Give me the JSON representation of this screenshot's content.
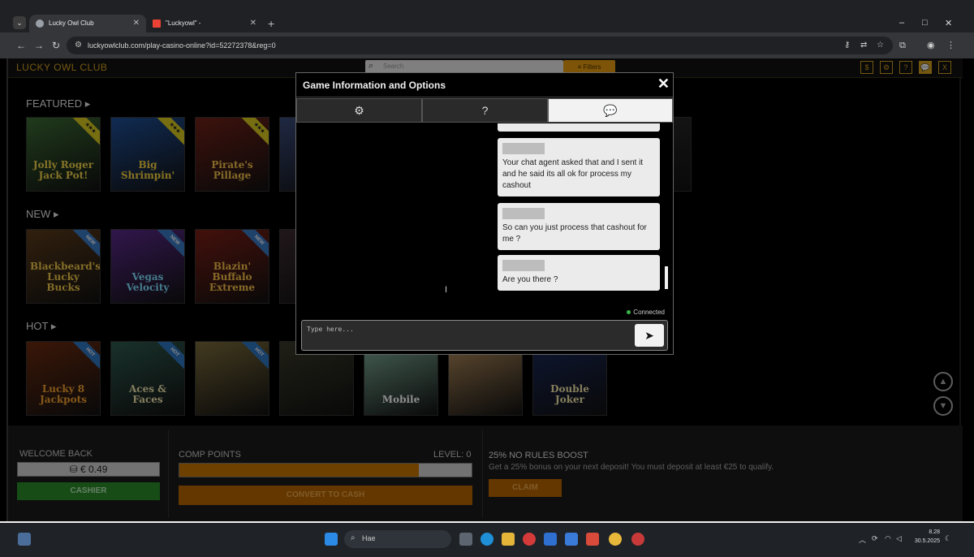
{
  "browser": {
    "tabs": [
      {
        "title": "Lucky Owl Club",
        "favicon_color": "#9aa0a6"
      },
      {
        "title": "\"Luckyowl\" -",
        "favicon_color": "#ea4335"
      }
    ],
    "new_tab": "+",
    "url": "luckyowlclub.com/play-casino-online?id=52272378&reg=0",
    "window_controls": [
      "–",
      "□",
      "✕"
    ]
  },
  "site": {
    "logo": "LUCKY OWL CLUB",
    "search_placeholder": "Search",
    "filters_label": "Filters",
    "header_icons": [
      "$",
      "⚙",
      "?",
      "💬",
      "X"
    ]
  },
  "sections": [
    {
      "title": "FEATURED ▸",
      "tiles": [
        {
          "name": "Jolly Roger Jack Pot!",
          "ribbon": "★★★",
          "bg": "#3b6a34",
          "fg": "#f3d34a"
        },
        {
          "name": "Big Shrimpin'",
          "ribbon": "★★★",
          "bg": "#1f4f96",
          "fg": "#f7d23e"
        },
        {
          "name": "Pirate's Pillage",
          "ribbon": "★★★",
          "bg": "#6f2118",
          "fg": "#f2c24a"
        },
        {
          "name": "",
          "ribbon": "",
          "bg": "#3a4a7a",
          "fg": "#f2c24a"
        },
        {
          "name": "",
          "ribbon": "",
          "bg": "#2a2520",
          "fg": "#ccc"
        },
        {
          "name": "",
          "ribbon": "",
          "bg": "#1f2b30",
          "fg": "#ccc"
        },
        {
          "name": "",
          "ribbon": "",
          "bg": "#252525",
          "fg": "#ccc"
        },
        {
          "name": "",
          "ribbon": "",
          "bg": "#2a2a2a",
          "fg": "#ccc"
        }
      ]
    },
    {
      "title": "NEW ▸",
      "tiles": [
        {
          "name": "Blackbeard's Lucky Bucks",
          "ribbon": "NEW",
          "bg": "#5a3a1a",
          "fg": "#f1c84a"
        },
        {
          "name": "Vegas Velocity",
          "ribbon": "NEW",
          "bg": "#5a2a8a",
          "fg": "#7fe0ff"
        },
        {
          "name": "Blazin' Buffalo Extreme",
          "ribbon": "NEW",
          "bg": "#7a1f15",
          "fg": "#f7c24a"
        },
        {
          "name": "",
          "ribbon": "",
          "bg": "#3a2a30",
          "fg": "#ccc"
        }
      ]
    },
    {
      "title": "HOT ▸",
      "tiles": [
        {
          "name": "Lucky 8 Jackpots",
          "ribbon": "HOT",
          "bg": "#6a2a10",
          "fg": "#f2a030"
        },
        {
          "name": "Aces & Faces",
          "ribbon": "HOT",
          "bg": "#2f5a4e",
          "fg": "#f1e6b0"
        },
        {
          "name": "",
          "ribbon": "HOT",
          "bg": "#7a6a3a",
          "fg": "#fff"
        },
        {
          "name": "",
          "ribbon": "",
          "bg": "#3a3a2a",
          "fg": "#fff"
        },
        {
          "name": "Mobile",
          "ribbon": "",
          "bg": "#7faf9a",
          "fg": "#ffffff"
        },
        {
          "name": "",
          "ribbon": "",
          "bg": "#b08a5a",
          "fg": "#fff"
        },
        {
          "name": "Double Joker",
          "ribbon": "",
          "bg": "#1a2a5a",
          "fg": "#f3e6a8"
        }
      ]
    }
  ],
  "bottom": {
    "welcome_label": "WELCOME BACK",
    "balance": "€ 0.49",
    "cashier_label": "CASHIER",
    "comp_points_label": "COMP POINTS",
    "level_label": "LEVEL: 0",
    "comp_progress": 0.82,
    "convert_label": "CONVERT TO CASH",
    "promo_title": "25% NO RULES BOOST",
    "promo_text": "Get a 25% bonus on your next deposit! You must deposit at least €25 to qualify.",
    "claim_label": "CLAIM"
  },
  "modal": {
    "title": "Game Information and Options",
    "close": "✕",
    "tabs": [
      "⚙",
      "?",
      "💬"
    ],
    "messages": [
      "",
      "Your chat agent asked that and I sent it and he said its all ok for process my cashout",
      "So can you just process that cashout for me ?",
      "Are you there ?"
    ],
    "status": "Connected",
    "input_placeholder": "Type here...",
    "send_icon": "➤"
  },
  "taskbar": {
    "search_placeholder": "Hae",
    "time": "8.28",
    "date": "30.5.2025"
  }
}
